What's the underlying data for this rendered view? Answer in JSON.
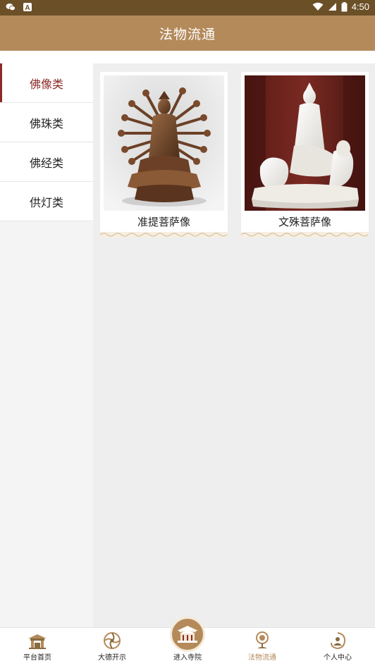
{
  "status_bar": {
    "time": "4:50"
  },
  "header": {
    "title": "法物流通"
  },
  "sidebar": {
    "items": [
      {
        "label": "佛像类",
        "active": true
      },
      {
        "label": "佛珠类",
        "active": false
      },
      {
        "label": "佛经类",
        "active": false
      },
      {
        "label": "供灯类",
        "active": false
      }
    ]
  },
  "products": [
    {
      "name": "准提菩萨像",
      "image": "bronze-multi-armed-bodhisattva-statue"
    },
    {
      "name": "文殊菩萨像",
      "image": "white-porcelain-bodhisattva-on-lion-statue"
    }
  ],
  "tabbar": {
    "items": [
      {
        "label": "平台首页",
        "icon": "temple-gate-icon",
        "active": false
      },
      {
        "label": "大德开示",
        "icon": "dharma-wheel-icon",
        "active": false
      },
      {
        "label": "进入寺院",
        "icon": "palace-icon",
        "active": false
      },
      {
        "label": "法物流通",
        "icon": "prayer-wheel-icon",
        "active": true
      },
      {
        "label": "个人中心",
        "icon": "person-lotus-icon",
        "active": false
      }
    ]
  },
  "colors": {
    "status_bar": "#6b4f27",
    "header": "#b48a5b",
    "active_side": "#8b2a27",
    "active_tab": "#b48a5b"
  }
}
